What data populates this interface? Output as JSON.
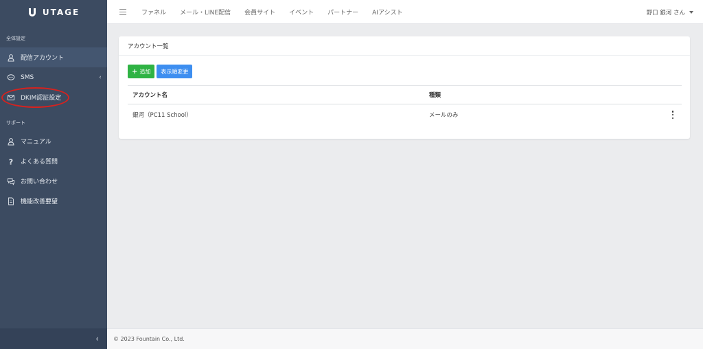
{
  "brand": {
    "logo_text": "UTAGE"
  },
  "sidebar": {
    "section1_title": "全体設定",
    "section2_title": "サポート",
    "items": [
      {
        "label": "配信アカウント",
        "icon": "user-icon"
      },
      {
        "label": "SMS",
        "icon": "chat-icon",
        "caret": "‹"
      },
      {
        "label": "DKIM認証設定",
        "icon": "mail-icon"
      },
      {
        "label": "マニュアル",
        "icon": "user-icon"
      },
      {
        "label": "よくある質問",
        "icon": "question-icon"
      },
      {
        "label": "お問い合わせ",
        "icon": "chat-bubbles-icon"
      },
      {
        "label": "機能改善要望",
        "icon": "document-icon"
      }
    ],
    "collapse_glyph": "‹"
  },
  "topbar": {
    "nav": [
      "ファネル",
      "メール・LINE配信",
      "会員サイト",
      "イベント",
      "パートナー",
      "AIアシスト"
    ],
    "user_name": "野口 銀河 さん"
  },
  "card": {
    "title": "アカウント一覧",
    "add_label": "追加",
    "add_icon": "+",
    "sort_label": "表示順変更",
    "columns": [
      "アカウント名",
      "種類"
    ],
    "rows": [
      {
        "name": "銀河（PC11 School）",
        "type": "メールのみ"
      }
    ]
  },
  "footer": {
    "copyright": "© 2023 Fountain Co., Ltd."
  },
  "colors": {
    "sidebar_bg": "#3c4b61",
    "add_button": "#2fb344",
    "sort_button": "#3d8ef0",
    "highlight_oval": "#d7221e"
  }
}
